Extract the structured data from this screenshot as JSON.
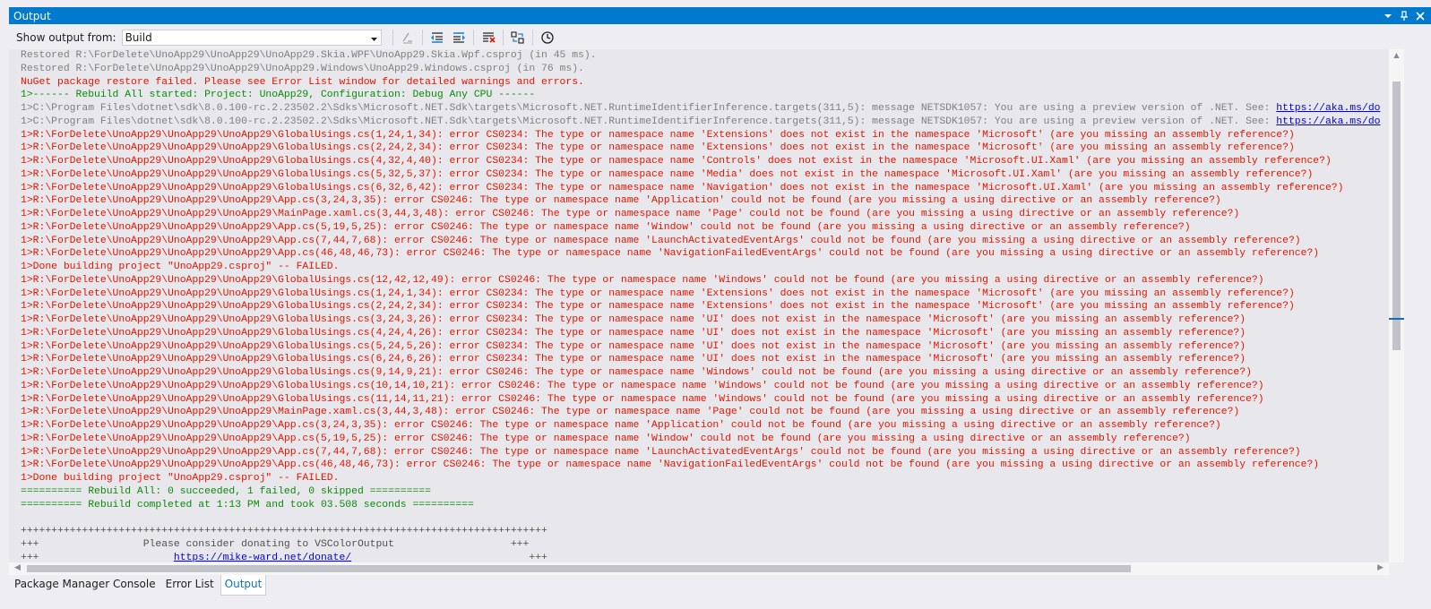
{
  "window": {
    "title": "Output",
    "title_bg": "#007acc"
  },
  "toolbar": {
    "show_output_label": "Show output from:",
    "source_selected": "Build",
    "buttons": [
      {
        "icon": "find-message-icon"
      },
      {
        "icon": "previous-message-icon"
      },
      {
        "icon": "next-message-icon"
      },
      {
        "icon": "clear-all-icon"
      },
      {
        "icon": "toggle-word-wrap-icon"
      },
      {
        "icon": "toggle-timestamps-icon"
      }
    ]
  },
  "colors": {
    "info": "#808080",
    "error": "#e51400",
    "success": "#0a8a0a",
    "donate": "#505050",
    "link": "#0000ee",
    "active_tab": "#0e70c0"
  },
  "output": {
    "lines": [
      {
        "type": "info",
        "text": "Restored R:\\ForDelete\\UnoApp29\\UnoApp29\\UnoApp29.Skia.WPF\\UnoApp29.Skia.Wpf.csproj (in 45 ms)."
      },
      {
        "type": "info",
        "text": "Restored R:\\ForDelete\\UnoApp29\\UnoApp29\\UnoApp29.Windows\\UnoApp29.Windows.csproj (in 76 ms)."
      },
      {
        "type": "error",
        "text": "NuGet package restore failed. Please see Error List window for detailed warnings and errors."
      },
      {
        "type": "success",
        "text": "1>------ Rebuild All started: Project: UnoApp29, Configuration: Debug Any CPU ------"
      },
      {
        "type": "info",
        "text": "1>C:\\Program Files\\dotnet\\sdk\\8.0.100-rc.2.23502.2\\Sdks\\Microsoft.NET.Sdk\\targets\\Microsoft.NET.RuntimeIdentifierInference.targets(311,5): message NETSDK1057: You are using a preview version of .NET. See: ",
        "link": "https://aka.ms/do"
      },
      {
        "type": "info",
        "text": "1>C:\\Program Files\\dotnet\\sdk\\8.0.100-rc.2.23502.2\\Sdks\\Microsoft.NET.Sdk\\targets\\Microsoft.NET.RuntimeIdentifierInference.targets(311,5): message NETSDK1057: You are using a preview version of .NET. See: ",
        "link": "https://aka.ms/do"
      },
      {
        "type": "error",
        "text": "1>R:\\ForDelete\\UnoApp29\\UnoApp29\\UnoApp29\\GlobalUsings.cs(1,24,1,34): error CS0234: The type or namespace name 'Extensions' does not exist in the namespace 'Microsoft' (are you missing an assembly reference?)"
      },
      {
        "type": "error",
        "text": "1>R:\\ForDelete\\UnoApp29\\UnoApp29\\UnoApp29\\GlobalUsings.cs(2,24,2,34): error CS0234: The type or namespace name 'Extensions' does not exist in the namespace 'Microsoft' (are you missing an assembly reference?)"
      },
      {
        "type": "error",
        "text": "1>R:\\ForDelete\\UnoApp29\\UnoApp29\\UnoApp29\\GlobalUsings.cs(4,32,4,40): error CS0234: The type or namespace name 'Controls' does not exist in the namespace 'Microsoft.UI.Xaml' (are you missing an assembly reference?)"
      },
      {
        "type": "error",
        "text": "1>R:\\ForDelete\\UnoApp29\\UnoApp29\\UnoApp29\\GlobalUsings.cs(5,32,5,37): error CS0234: The type or namespace name 'Media' does not exist in the namespace 'Microsoft.UI.Xaml' (are you missing an assembly reference?)"
      },
      {
        "type": "error",
        "text": "1>R:\\ForDelete\\UnoApp29\\UnoApp29\\UnoApp29\\GlobalUsings.cs(6,32,6,42): error CS0234: The type or namespace name 'Navigation' does not exist in the namespace 'Microsoft.UI.Xaml' (are you missing an assembly reference?)"
      },
      {
        "type": "error",
        "text": "1>R:\\ForDelete\\UnoApp29\\UnoApp29\\UnoApp29\\App.cs(3,24,3,35): error CS0246: The type or namespace name 'Application' could not be found (are you missing a using directive or an assembly reference?)"
      },
      {
        "type": "error",
        "text": "1>R:\\ForDelete\\UnoApp29\\UnoApp29\\UnoApp29\\MainPage.xaml.cs(3,44,3,48): error CS0246: The type or namespace name 'Page' could not be found (are you missing a using directive or an assembly reference?)"
      },
      {
        "type": "error",
        "text": "1>R:\\ForDelete\\UnoApp29\\UnoApp29\\UnoApp29\\App.cs(5,19,5,25): error CS0246: The type or namespace name 'Window' could not be found (are you missing a using directive or an assembly reference?)"
      },
      {
        "type": "error",
        "text": "1>R:\\ForDelete\\UnoApp29\\UnoApp29\\UnoApp29\\App.cs(7,44,7,68): error CS0246: The type or namespace name 'LaunchActivatedEventArgs' could not be found (are you missing a using directive or an assembly reference?)"
      },
      {
        "type": "error",
        "text": "1>R:\\ForDelete\\UnoApp29\\UnoApp29\\UnoApp29\\App.cs(46,48,46,73): error CS0246: The type or namespace name 'NavigationFailedEventArgs' could not be found (are you missing a using directive or an assembly reference?)"
      },
      {
        "type": "error",
        "text": "1>Done building project \"UnoApp29.csproj\" -- FAILED."
      },
      {
        "type": "error",
        "text": "1>R:\\ForDelete\\UnoApp29\\UnoApp29\\UnoApp29\\GlobalUsings.cs(12,42,12,49): error CS0246: The type or namespace name 'Windows' could not be found (are you missing a using directive or an assembly reference?)"
      },
      {
        "type": "error",
        "text": "1>R:\\ForDelete\\UnoApp29\\UnoApp29\\UnoApp29\\GlobalUsings.cs(1,24,1,34): error CS0234: The type or namespace name 'Extensions' does not exist in the namespace 'Microsoft' (are you missing an assembly reference?)"
      },
      {
        "type": "error",
        "text": "1>R:\\ForDelete\\UnoApp29\\UnoApp29\\UnoApp29\\GlobalUsings.cs(2,24,2,34): error CS0234: The type or namespace name 'Extensions' does not exist in the namespace 'Microsoft' (are you missing an assembly reference?)"
      },
      {
        "type": "error",
        "text": "1>R:\\ForDelete\\UnoApp29\\UnoApp29\\UnoApp29\\GlobalUsings.cs(3,24,3,26): error CS0234: The type or namespace name 'UI' does not exist in the namespace 'Microsoft' (are you missing an assembly reference?)"
      },
      {
        "type": "error",
        "text": "1>R:\\ForDelete\\UnoApp29\\UnoApp29\\UnoApp29\\GlobalUsings.cs(4,24,4,26): error CS0234: The type or namespace name 'UI' does not exist in the namespace 'Microsoft' (are you missing an assembly reference?)"
      },
      {
        "type": "error",
        "text": "1>R:\\ForDelete\\UnoApp29\\UnoApp29\\UnoApp29\\GlobalUsings.cs(5,24,5,26): error CS0234: The type or namespace name 'UI' does not exist in the namespace 'Microsoft' (are you missing an assembly reference?)"
      },
      {
        "type": "error",
        "text": "1>R:\\ForDelete\\UnoApp29\\UnoApp29\\UnoApp29\\GlobalUsings.cs(6,24,6,26): error CS0234: The type or namespace name 'UI' does not exist in the namespace 'Microsoft' (are you missing an assembly reference?)"
      },
      {
        "type": "error",
        "text": "1>R:\\ForDelete\\UnoApp29\\UnoApp29\\UnoApp29\\GlobalUsings.cs(9,14,9,21): error CS0246: The type or namespace name 'Windows' could not be found (are you missing a using directive or an assembly reference?)"
      },
      {
        "type": "error",
        "text": "1>R:\\ForDelete\\UnoApp29\\UnoApp29\\UnoApp29\\GlobalUsings.cs(10,14,10,21): error CS0246: The type or namespace name 'Windows' could not be found (are you missing a using directive or an assembly reference?)"
      },
      {
        "type": "error",
        "text": "1>R:\\ForDelete\\UnoApp29\\UnoApp29\\UnoApp29\\GlobalUsings.cs(11,14,11,21): error CS0246: The type or namespace name 'Windows' could not be found (are you missing a using directive or an assembly reference?)"
      },
      {
        "type": "error",
        "text": "1>R:\\ForDelete\\UnoApp29\\UnoApp29\\UnoApp29\\MainPage.xaml.cs(3,44,3,48): error CS0246: The type or namespace name 'Page' could not be found (are you missing a using directive or an assembly reference?)"
      },
      {
        "type": "error",
        "text": "1>R:\\ForDelete\\UnoApp29\\UnoApp29\\UnoApp29\\App.cs(3,24,3,35): error CS0246: The type or namespace name 'Application' could not be found (are you missing a using directive or an assembly reference?)"
      },
      {
        "type": "error",
        "text": "1>R:\\ForDelete\\UnoApp29\\UnoApp29\\UnoApp29\\App.cs(5,19,5,25): error CS0246: The type or namespace name 'Window' could not be found (are you missing a using directive or an assembly reference?)"
      },
      {
        "type": "error",
        "text": "1>R:\\ForDelete\\UnoApp29\\UnoApp29\\UnoApp29\\App.cs(7,44,7,68): error CS0246: The type or namespace name 'LaunchActivatedEventArgs' could not be found (are you missing a using directive or an assembly reference?)"
      },
      {
        "type": "error",
        "text": "1>R:\\ForDelete\\UnoApp29\\UnoApp29\\UnoApp29\\App.cs(46,48,46,73): error CS0246: The type or namespace name 'NavigationFailedEventArgs' could not be found (are you missing a using directive or an assembly reference?)"
      },
      {
        "type": "error",
        "text": "1>Done building project \"UnoApp29.csproj\" -- FAILED."
      },
      {
        "type": "success",
        "text": "========== Rebuild All: 0 succeeded, 1 failed, 0 skipped =========="
      },
      {
        "type": "success",
        "text": "========== Rebuild completed at 1:13 PM and took 03.508 seconds =========="
      },
      {
        "type": "donate",
        "text": ""
      },
      {
        "type": "donate",
        "text": "++++++++++++++++++++++++++++++++++++++++++++++++++++++++++++++++++++++++++++++++++++++"
      },
      {
        "type": "donate",
        "text": "+++                 Please consider donating to VSColorOutput                   +++"
      },
      {
        "type": "donate",
        "text": "+++                      ",
        "link": "https://mike-ward.net/donate/",
        "suffix": "                             +++"
      }
    ]
  },
  "tabs": [
    {
      "label": "Package Manager Console",
      "active": false
    },
    {
      "label": "Error List",
      "active": false
    },
    {
      "label": "Output",
      "active": true
    }
  ]
}
